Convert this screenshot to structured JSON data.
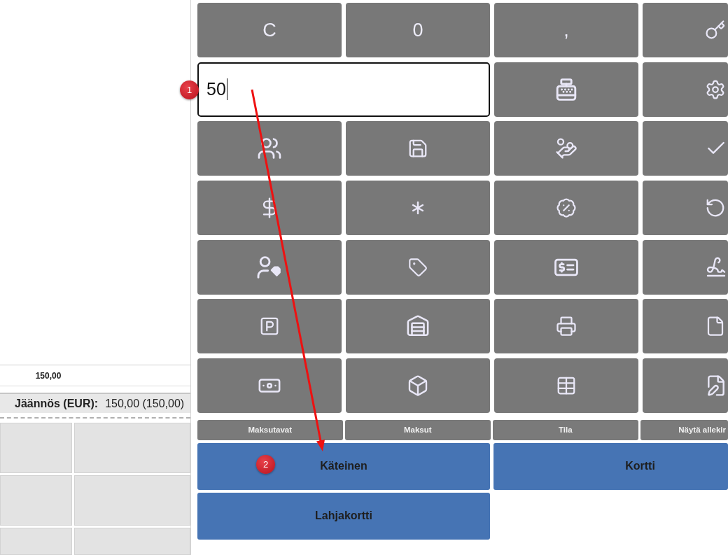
{
  "receipt_table": {
    "total_cells": [
      "150,00"
    ]
  },
  "balance": {
    "label": "Jäännös (EUR):",
    "value": "150,00 (150,00)"
  },
  "keypad": {
    "keys": [
      {
        "kind": "text",
        "label": "C"
      },
      {
        "kind": "text",
        "label": "0"
      },
      {
        "kind": "text",
        "label": ","
      },
      {
        "kind": "icon"
      },
      {
        "kind": "icon"
      },
      {
        "kind": "icon"
      },
      {
        "kind": "icon"
      },
      {
        "kind": "icon"
      },
      {
        "kind": "icon"
      },
      {
        "kind": "icon"
      },
      {
        "kind": "icon"
      },
      {
        "kind": "icon"
      },
      {
        "kind": "icon"
      },
      {
        "kind": "icon"
      },
      {
        "kind": "icon"
      },
      {
        "kind": "icon"
      },
      {
        "kind": "icon"
      },
      {
        "kind": "icon"
      },
      {
        "kind": "icon"
      },
      {
        "kind": "icon"
      },
      {
        "kind": "icon"
      },
      {
        "kind": "icon"
      },
      {
        "kind": "icon"
      },
      {
        "kind": "icon"
      },
      {
        "kind": "icon"
      },
      {
        "kind": "icon"
      }
    ],
    "amount_field": {
      "value": "50",
      "focused": true
    }
  },
  "section_buttons": [
    {
      "label": "Maksutavat"
    },
    {
      "label": "Maksut"
    },
    {
      "label": "Tila"
    },
    {
      "label": "Näytä allekir"
    }
  ],
  "payment_buttons": [
    {
      "label": "Käteinen"
    },
    {
      "label": "Kortti"
    },
    {
      "label": "Lahjakortti"
    }
  ],
  "annotations": [
    {
      "kind": "marker",
      "number": "1"
    },
    {
      "kind": "arrow"
    },
    {
      "kind": "marker",
      "number": "2"
    }
  ]
}
